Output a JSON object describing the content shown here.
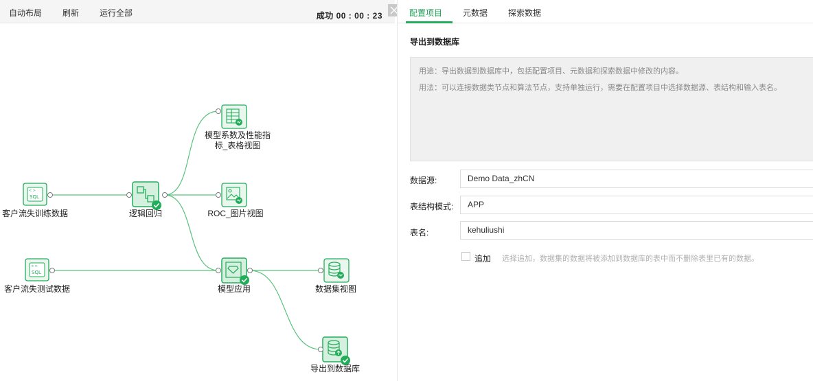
{
  "toolbar": {
    "auto_layout": "自动布局",
    "refresh": "刷新",
    "run_all": "运行全部",
    "timer": "成功 00 : 00 : 23"
  },
  "flow": {
    "nodes": {
      "train_data": "客户流失训练数据",
      "test_data": "客户流失测试数据",
      "logistic": "逻辑回归",
      "coef_line1": "模型系数及性能指",
      "coef_line2": "标_表格视图",
      "roc": "ROC_图片视图",
      "model_apply": "模型应用",
      "dataset_view": "数据集视图",
      "export_db": "导出到数据库",
      "sql_icon_text": "SQL"
    }
  },
  "tabs": {
    "config": "配置项目",
    "metadata": "元数据",
    "explore": "探索数据"
  },
  "panel": {
    "title": "导出到数据库",
    "usage": "用途：导出数据到数据库中，包括配置项目、元数据和探索数据中修改的内容。",
    "method": "用法：可以连接数据类节点和算法节点，支持单独运行，需要在配置项目中选择数据源、表结构和输入表名。",
    "datasource_label": "数据源:",
    "datasource_value": "Demo Data_zhCN",
    "schema_label": "表结构模式:",
    "schema_value": "APP",
    "table_label": "表名:",
    "table_value": "kehuliushi",
    "append_label": "追加",
    "append_hint": "选择追加，数据集的数据将被添加到数据库的表中而不删除表里已有的数据。"
  },
  "colors": {
    "accent": "#23ad5b",
    "edge": "#5ac27e",
    "node_fill": "#e9f7ee"
  }
}
